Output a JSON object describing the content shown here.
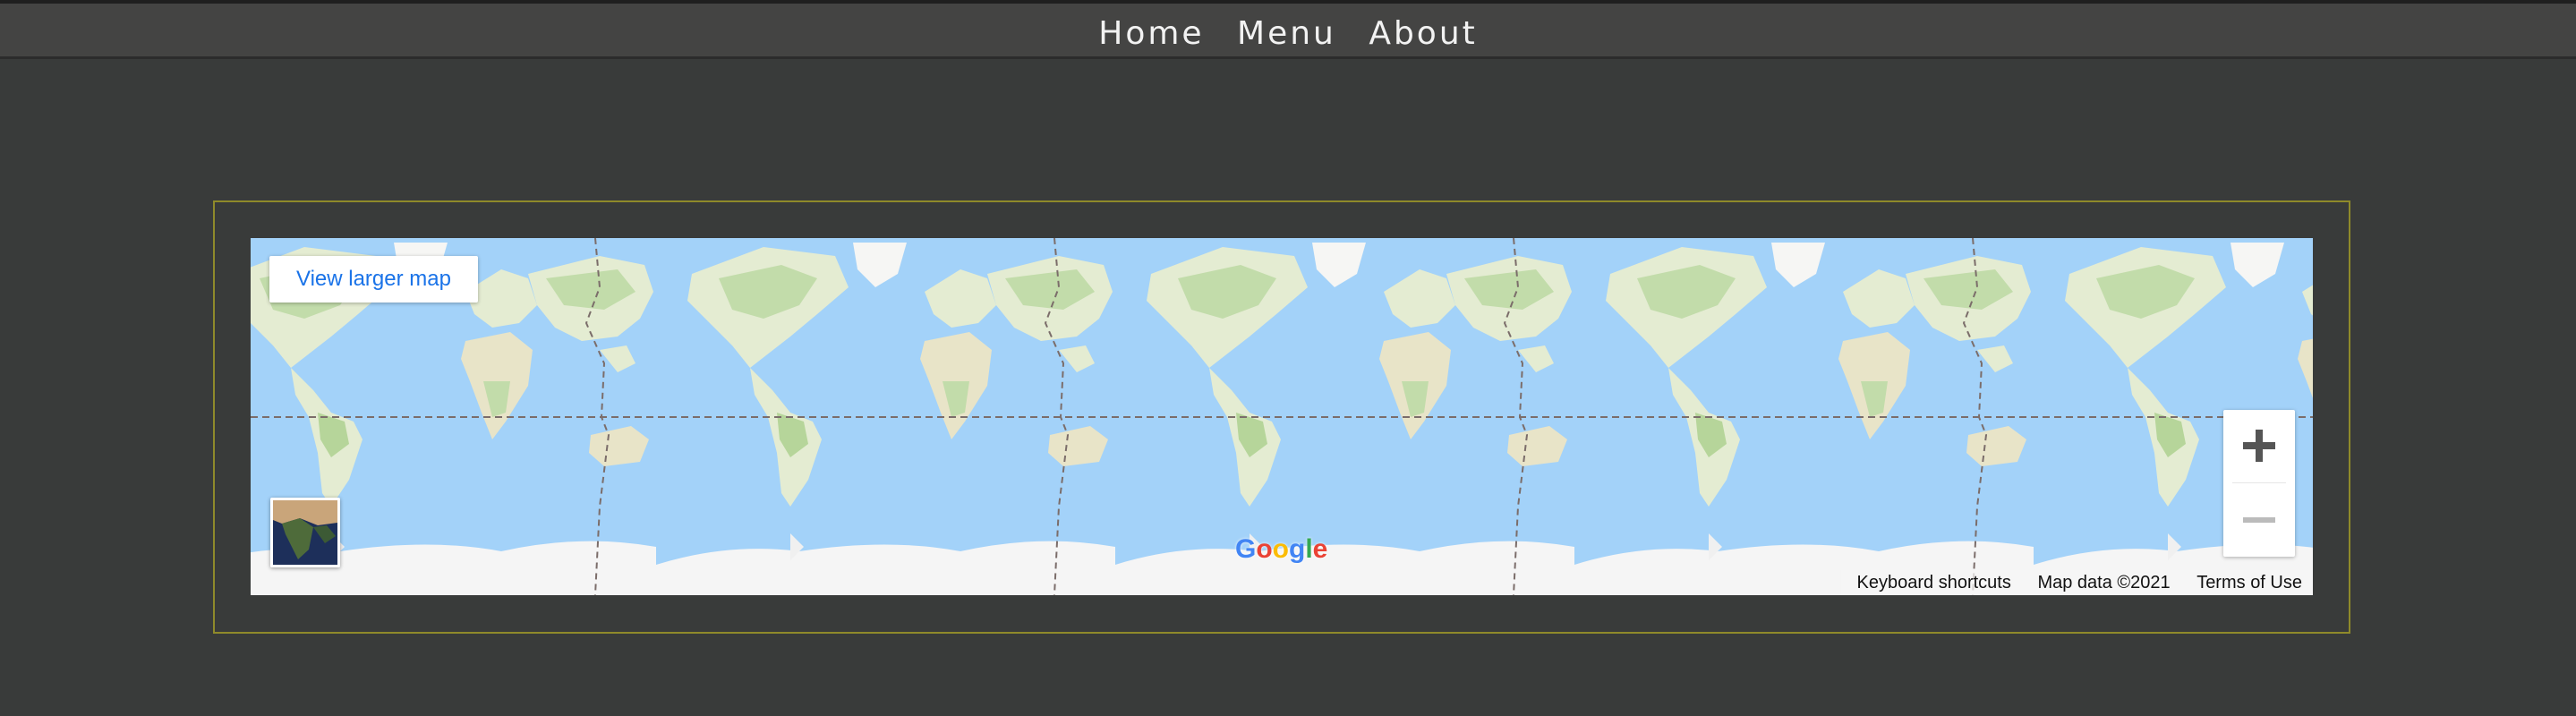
{
  "nav": {
    "items": [
      "Home",
      "Menu",
      "About"
    ]
  },
  "map": {
    "view_larger_label": "View larger map",
    "zoom_in_glyph": "+",
    "zoom_out_glyph": "−",
    "logo_letters": [
      "G",
      "o",
      "o",
      "g",
      "l",
      "e"
    ],
    "attribution": {
      "shortcuts": "Keyboard shortcuts",
      "data": "Map data ©2021",
      "terms": "Terms of Use"
    },
    "icons": {
      "zoom_in": "plus-icon",
      "zoom_out": "minus-icon",
      "layer": "satellite-layer-thumbnail"
    }
  },
  "colors": {
    "page_bg": "#393b3a",
    "topbar_bg": "#444443",
    "frame_border": "#8f8a2a",
    "ocean": "#a3d2f9",
    "land": "#e4ecd2",
    "forest": "#c2dcaa",
    "link_blue": "#1a73e8",
    "logo": [
      "#4285f4",
      "#ea4335",
      "#fbbc05",
      "#4285f4",
      "#34a853",
      "#ea4335"
    ]
  }
}
